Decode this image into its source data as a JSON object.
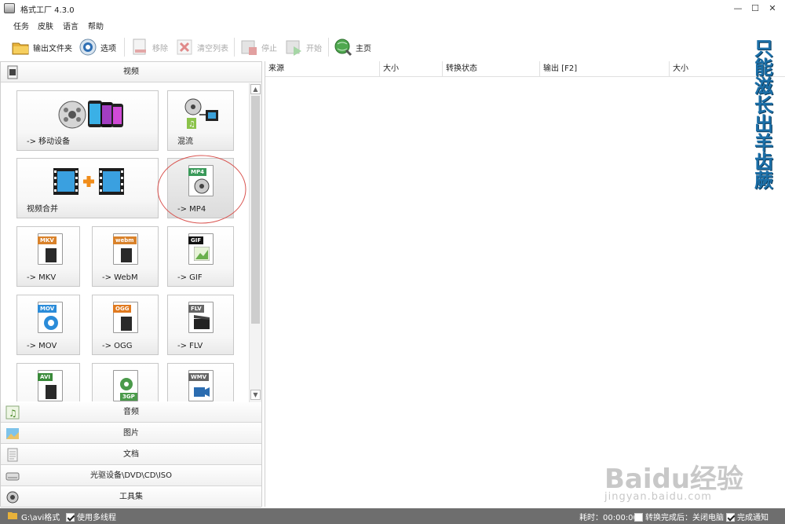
{
  "window": {
    "title": "格式工厂 4.3.0",
    "controls": [
      "—",
      "☐",
      "✕"
    ]
  },
  "menu": [
    "任务",
    "皮肤",
    "语言",
    "帮助"
  ],
  "toolbar": {
    "output_folder": "输出文件夹",
    "options": "选项",
    "remove": "移除",
    "clear_list": "清空列表",
    "stop": "停止",
    "start": "开始",
    "home": "主页"
  },
  "categories": {
    "video": "视频",
    "audio": "音频",
    "image": "图片",
    "document": "文档",
    "optical": "光驱设备\\DVD\\CD\\ISO",
    "tools": "工具集"
  },
  "tiles": [
    {
      "label": "-> 移动设备"
    },
    {
      "label": "混流"
    },
    {
      "label": "视频合并"
    },
    {
      "label": "-> MP4",
      "badge": "MP4",
      "badge_color": "#3a9a5a"
    },
    {
      "label": "-> MKV",
      "badge": "MKV",
      "badge_color": "#d9822b"
    },
    {
      "label": "-> WebM",
      "badge": "webm",
      "badge_color": "#d9822b"
    },
    {
      "label": "-> GIF",
      "badge": "GIF",
      "badge_color": "#111111"
    },
    {
      "label": "-> MOV",
      "badge": "MOV",
      "badge_color": "#2b8cd9"
    },
    {
      "label": "-> OGG",
      "badge": "OGG",
      "badge_color": "#e07a20"
    },
    {
      "label": "-> FLV",
      "badge": "FLV",
      "badge_color": "#666666"
    },
    {
      "label": "",
      "badge": "AVI",
      "badge_color": "#3a8a3a"
    },
    {
      "label": "",
      "badge": "3GP",
      "badge_color": "#4a9a4a"
    },
    {
      "label": "",
      "badge": "WMV",
      "badge_color": "#666666"
    }
  ],
  "list_columns": [
    "来源",
    "大小",
    "转换状态",
    "输出 [F2]",
    "大小"
  ],
  "watermark": {
    "vertical_text": "只能滋长出羊齿蕨",
    "baidu": "Baidu经验",
    "url": "jingyan.baidu.com"
  },
  "status": {
    "path": "G:\\avi格式",
    "multithread": "使用多线程",
    "elapsed": "耗时：00:00:00",
    "after_convert": "转换完成后：关闭电脑",
    "notify": "完成通知"
  },
  "colors": {
    "accent": "#2b8cd9",
    "statusbar": "#6e6e6e",
    "selection_circle": "#d9534f"
  }
}
